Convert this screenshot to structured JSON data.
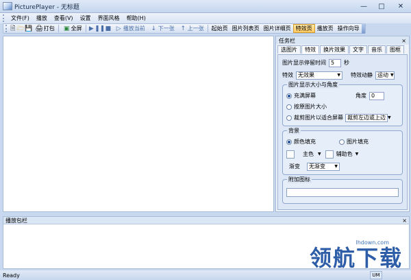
{
  "window": {
    "title": "PicturePlayer - 无标题"
  },
  "menu": [
    "文件(F)",
    "播放",
    "查看(V)",
    "设置",
    "界面风格",
    "帮助(H)"
  ],
  "toolbar": {
    "print": "打包",
    "fullscreen": "全屏",
    "play_current": "播放当前",
    "next": "下一张",
    "prev": "上一张",
    "start_page": "起始页",
    "list_page": "图片列表页",
    "detail_page": "图片详细页",
    "effect_page": "特效页",
    "play_page": "播放页",
    "wizard": "操作向导"
  },
  "task_pane": {
    "title": "任务栏",
    "close": "×",
    "tabs": [
      "选图片",
      "特效",
      "换片效果",
      "文字",
      "音乐",
      "图框"
    ],
    "display_time_label": "图片显示停留时间",
    "display_time_value": "5",
    "display_time_unit": "秒",
    "effect_label": "特效",
    "effect_value": "无效果",
    "motion_label": "特效动静",
    "motion_value": "运动",
    "size_group": {
      "title": "图片显示大小与角度",
      "fill_label": "充满屏幕",
      "angle_label": "角度",
      "angle_value": "0",
      "original_label": "按原图片大小",
      "crop_label": "裁剪图片以适合屏幕",
      "crop_value": "裁剪左边或上边"
    },
    "bg_group": {
      "title": "背景",
      "color_fill": "颜色填充",
      "image_fill": "图片填充",
      "main_color": "主色",
      "aux_color": "辅助色",
      "gradient_label": "渐变",
      "gradient_value": "无渐变"
    },
    "extra_group": {
      "title": "附加图标"
    }
  },
  "bottom_pane": {
    "title": "播放包栏",
    "close": "×"
  },
  "status": {
    "text": "Ready",
    "cell": "UM"
  },
  "watermark": {
    "site": "lhdown.com",
    "brand": "领航下载"
  }
}
